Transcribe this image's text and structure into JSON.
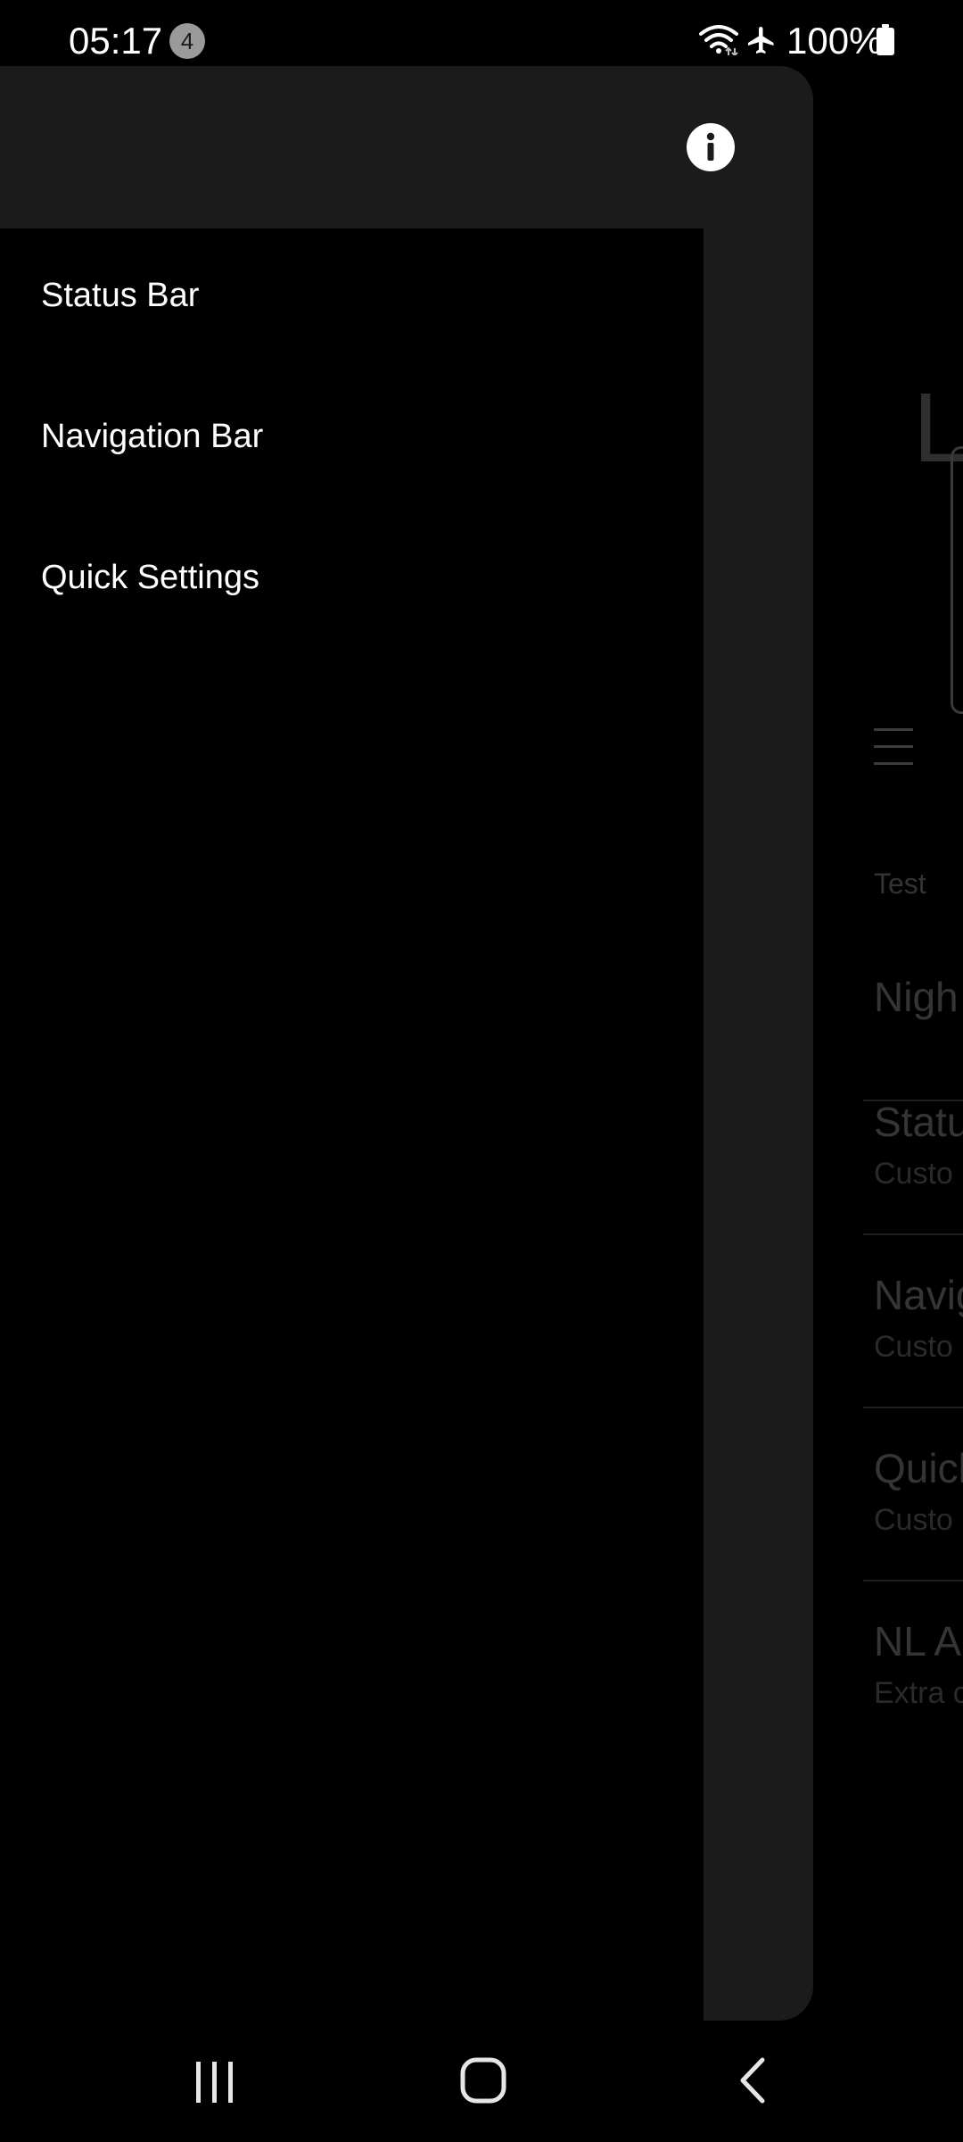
{
  "status_bar": {
    "time": "05:17",
    "notification_count": "4",
    "battery": "100%",
    "icons": [
      "wifi-icon",
      "airplane-mode-icon",
      "battery-icon"
    ]
  },
  "drawer": {
    "header_icon": "info-icon",
    "items": [
      {
        "label": "Status Bar"
      },
      {
        "label": "Navigation Bar"
      },
      {
        "label": "Quick Settings"
      }
    ]
  },
  "background": {
    "big_letter": "L",
    "section_header": "Test",
    "items": [
      {
        "title": "Nigh",
        "subtitle": ""
      },
      {
        "title": "Statu",
        "subtitle": "Custo"
      },
      {
        "title": "Navig",
        "subtitle": "Custo"
      },
      {
        "title": "Quick",
        "subtitle": "Custo"
      },
      {
        "title": "NL A",
        "subtitle": "Extra c"
      }
    ]
  },
  "nav_bar": {
    "icons": [
      "recent-apps-icon",
      "home-icon",
      "back-icon"
    ]
  },
  "colors": {
    "background": "#000000",
    "drawer_surface": "#1b1b1b",
    "text_primary": "#ffffff",
    "dim_text": "#353535"
  }
}
